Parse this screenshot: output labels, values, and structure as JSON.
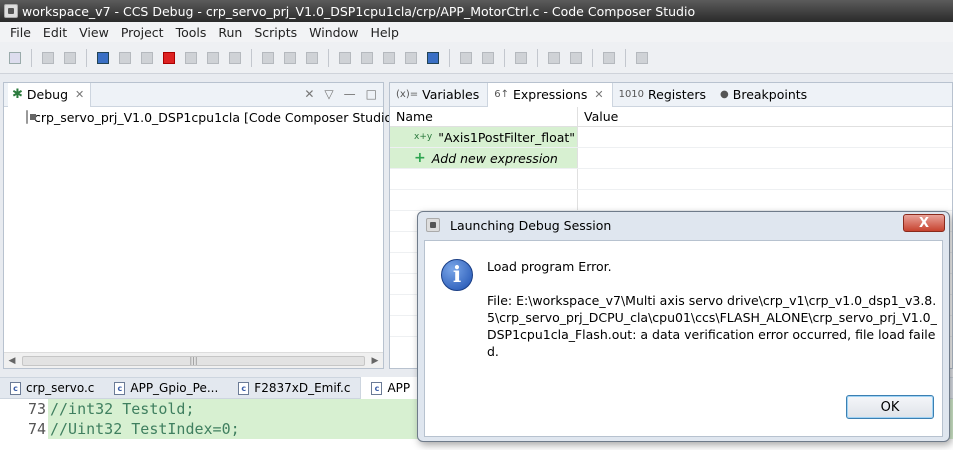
{
  "window": {
    "title": "workspace_v7 - CCS Debug - crp_servo_prj_V1.0_DSP1cpu1cla/crp/APP_MotorCtrl.c - Code Composer Studio"
  },
  "menu": [
    "File",
    "Edit",
    "View",
    "Project",
    "Tools",
    "Run",
    "Scripts",
    "Window",
    "Help"
  ],
  "debug_view": {
    "tab_label": "Debug",
    "tree_item": "crp_servo_prj_V1.0_DSP1cpu1cla [Code Composer Studio"
  },
  "right_view": {
    "tabs": [
      {
        "icon": "(x)=",
        "label": "Variables"
      },
      {
        "icon": "6↑",
        "label": "Expressions"
      },
      {
        "icon": "1010",
        "label": "Registers"
      },
      {
        "icon": "●",
        "label": "Breakpoints"
      }
    ],
    "columns": {
      "name": "Name",
      "value": "Value"
    },
    "expressions": [
      {
        "name": "\"Axis1PostFilter_float\"",
        "value": ""
      },
      {
        "name": "Add new expression",
        "value": ""
      }
    ]
  },
  "editor_tabs": [
    "crp_servo.c",
    "APP_Gpio_Pe...",
    "F2837xD_Emif.c",
    "APP"
  ],
  "editor": {
    "lines": [
      {
        "num": "73",
        "code": "//int32 Testold;"
      },
      {
        "num": "74",
        "code": "//Uint32 TestIndex=0;"
      }
    ]
  },
  "dialog": {
    "title": "Launching Debug Session",
    "close_label": "X",
    "message_title": "Load program Error.",
    "message_body": "File: E:\\workspace_v7\\Multi axis servo drive\\crp_v1\\crp_v1.0_dsp1_v3.8.5\\crp_servo_prj_DCPU_cla\\cpu01\\ccs\\FLASH_ALONE\\crp_servo_prj_V1.0_DSP1cpu1cla_Flash.out: a data verification error occurred, file load failed.",
    "ok_label": "OK",
    "info_glyph": "i"
  }
}
